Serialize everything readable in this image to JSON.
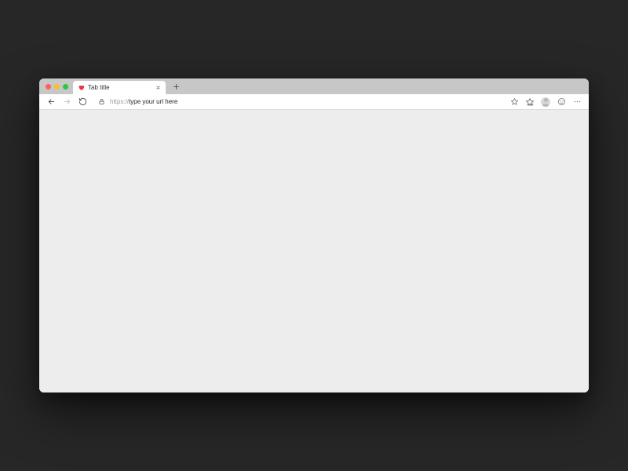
{
  "tab": {
    "title": "Tab title"
  },
  "address": {
    "protocol": "https://",
    "url_value": "type your url here"
  }
}
